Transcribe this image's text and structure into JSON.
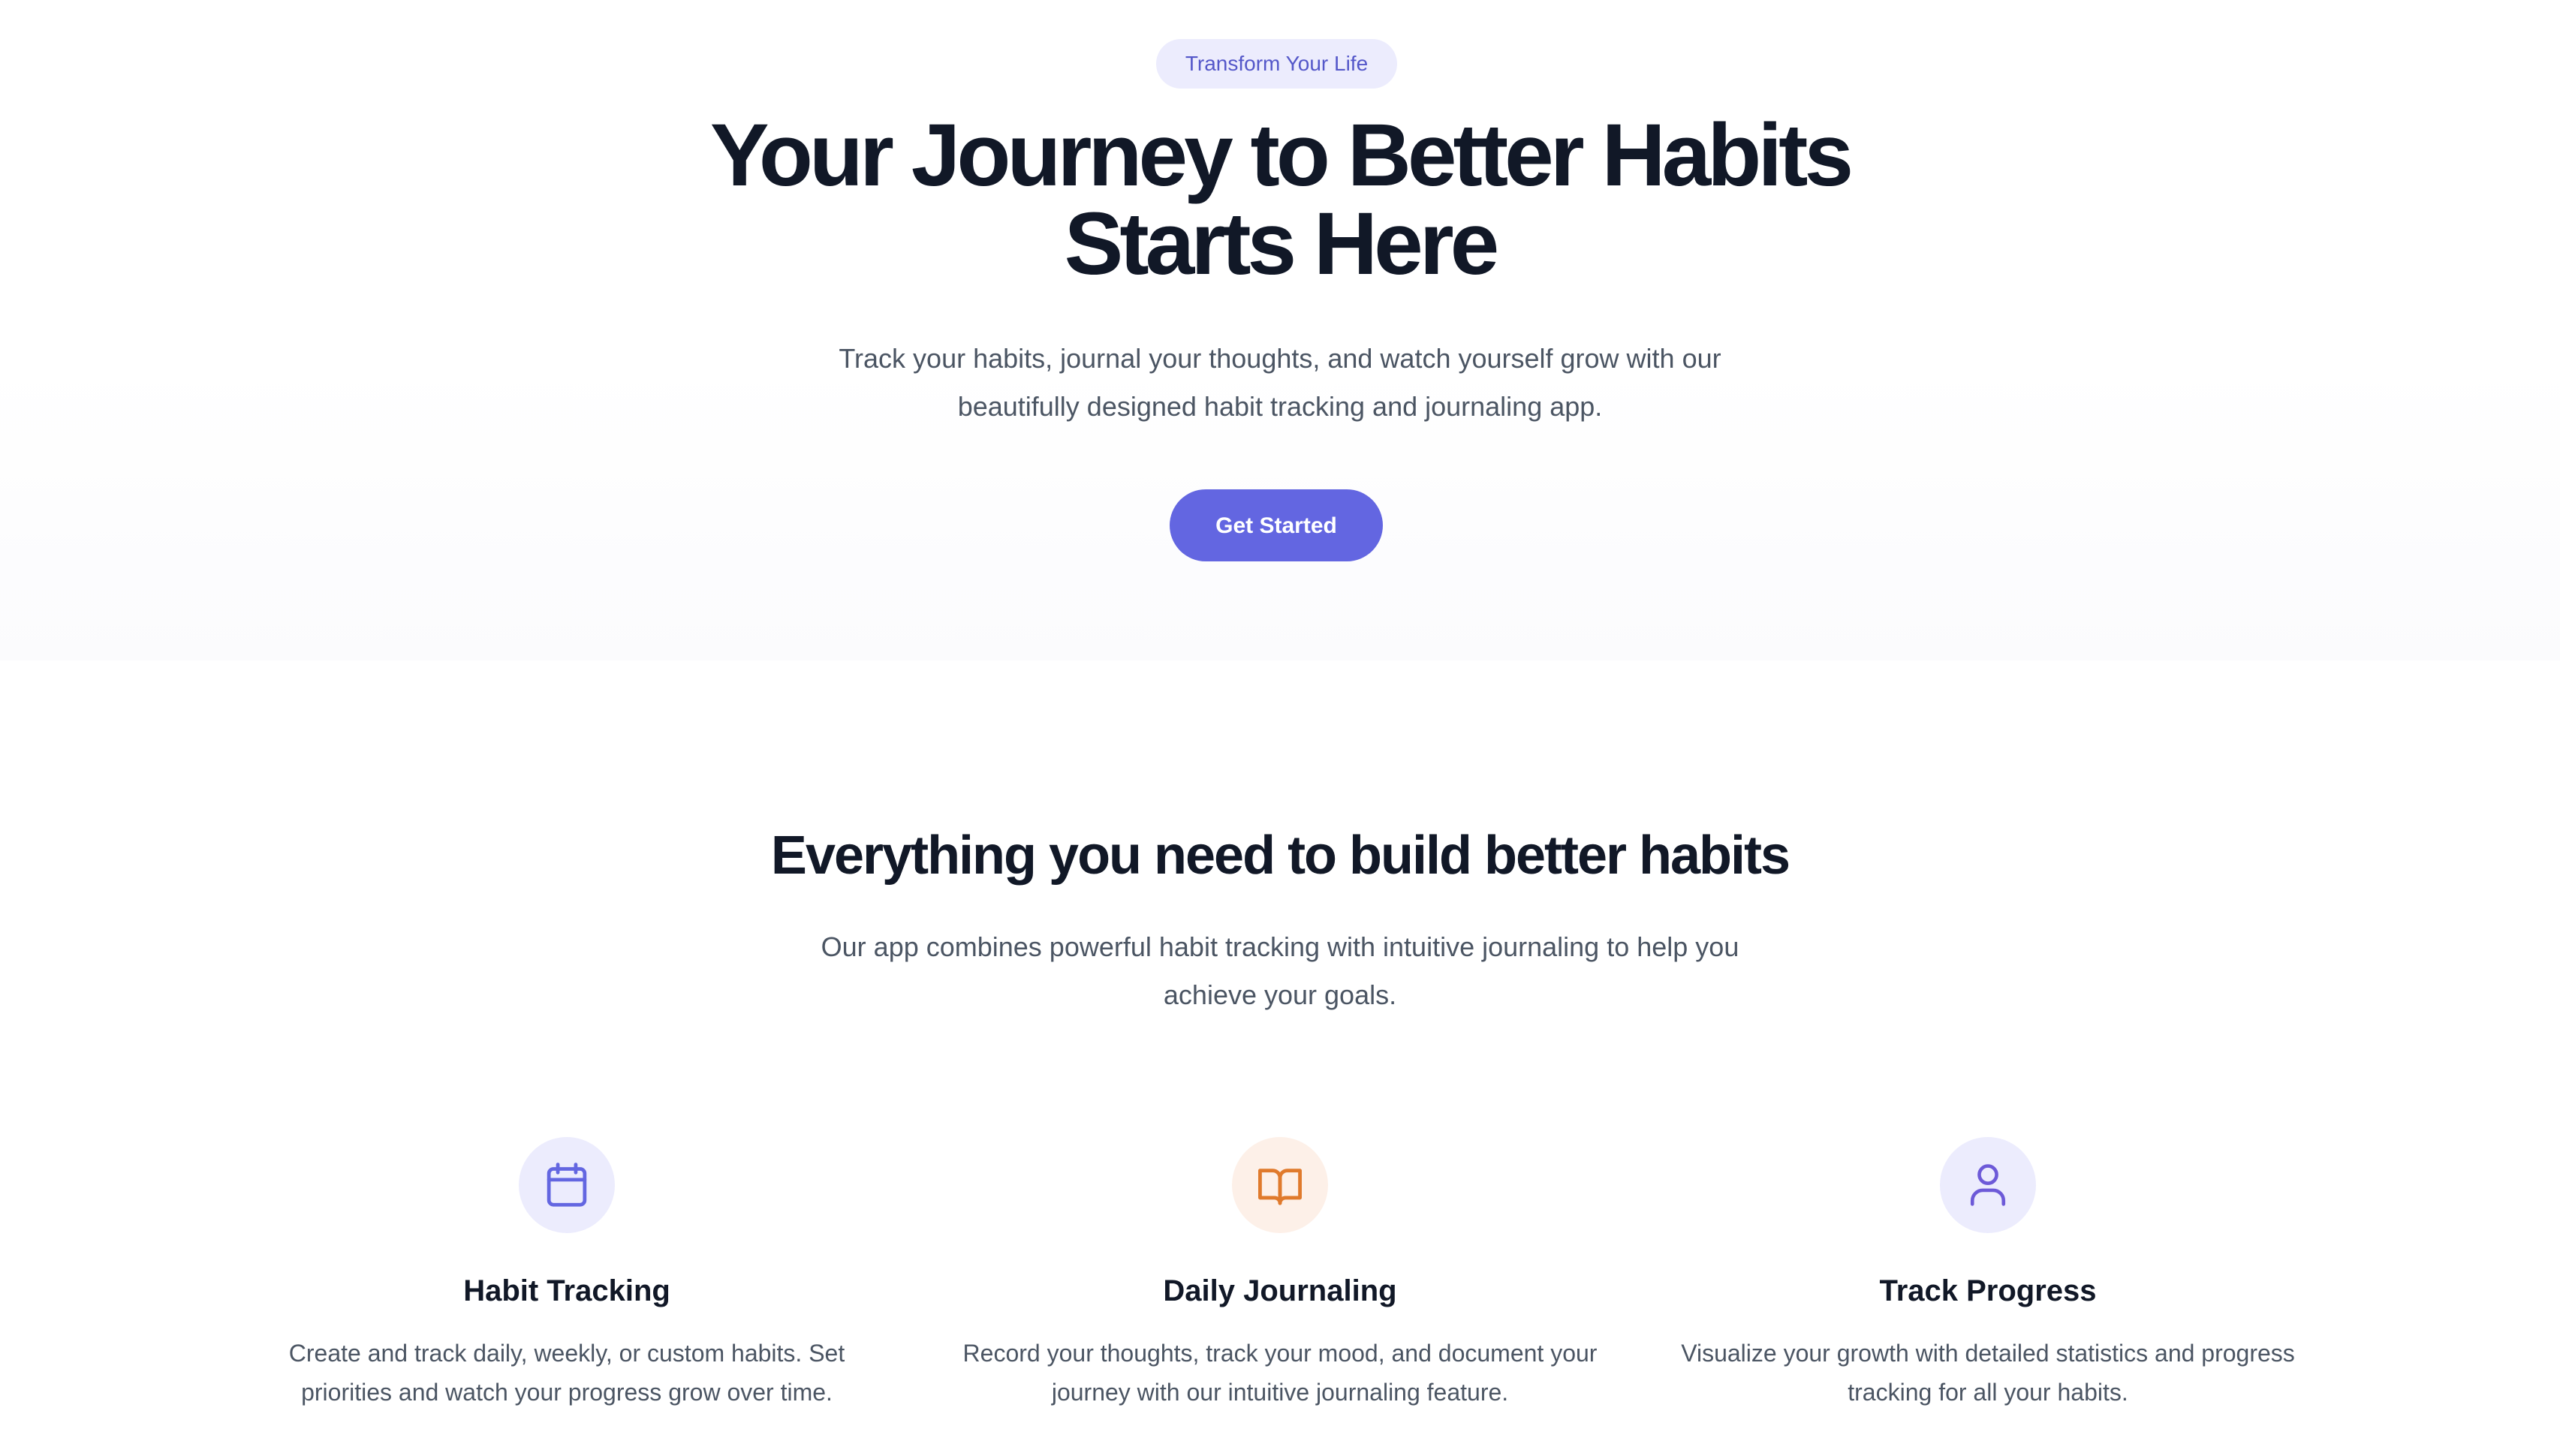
{
  "hero": {
    "badge": "Transform Your Life",
    "title_line1": "Your Journey to Better Habits",
    "title_line2": "Starts Here",
    "subtitle": "Track your habits, journal your thoughts, and watch yourself grow with our beautifully designed habit tracking and journaling app.",
    "cta_label": "Get Started"
  },
  "features": {
    "title": "Everything you need to build better habits",
    "subtitle": "Our app combines powerful habit tracking with intuitive journaling to help you achieve your goals.",
    "items": [
      {
        "icon": "calendar-icon",
        "title": "Habit Tracking",
        "description": "Create and track daily, weekly, or custom habits. Set priorities and watch your progress grow over time."
      },
      {
        "icon": "book-open-icon",
        "title": "Daily Journaling",
        "description": "Record your thoughts, track your mood, and document your journey with our intuitive journaling feature."
      },
      {
        "icon": "user-icon",
        "title": "Track Progress",
        "description": "Visualize your growth with detailed statistics and progress tracking for all your habits."
      }
    ]
  },
  "colors": {
    "accent": "#6366e1",
    "badge_bg": "#ececfd",
    "badge_text": "#5457c9",
    "orange_accent": "#e07a2c",
    "orange_bg": "#fdf0e8",
    "heading": "#111827",
    "body_text": "#4b5563"
  }
}
